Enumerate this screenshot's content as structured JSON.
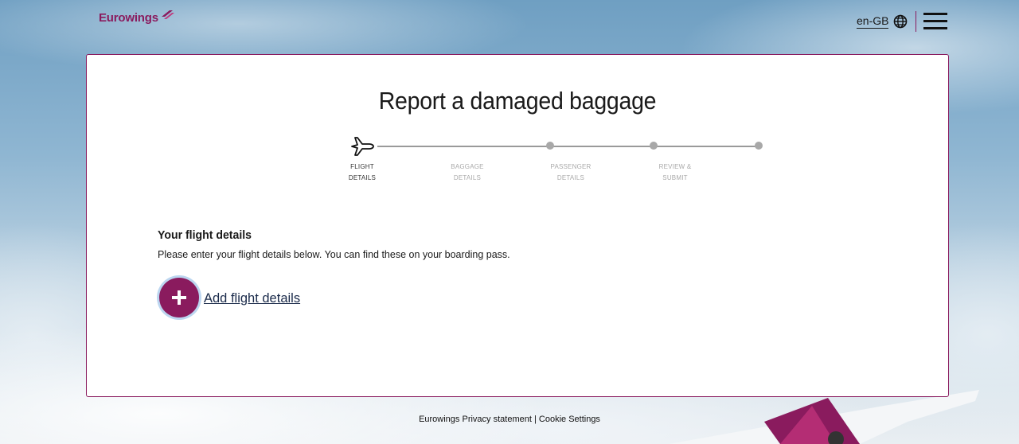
{
  "brand": {
    "name": "Eurowings",
    "color": "#8a1b5e"
  },
  "header": {
    "language": "en-GB",
    "language_icon": "globe-icon",
    "menu_icon": "hamburger-menu-icon"
  },
  "main": {
    "title": "Report a damaged baggage",
    "steps": [
      {
        "line1": "FLIGHT",
        "line2": "DETAILS",
        "active": true
      },
      {
        "line1": "BAGGAGE",
        "line2": "DETAILS",
        "active": false
      },
      {
        "line1": "PASSENGER",
        "line2": "DETAILS",
        "active": false
      },
      {
        "line1": "REVIEW &",
        "line2": "SUBMIT",
        "active": false
      }
    ],
    "section_title": "Your flight details",
    "section_text": "Please enter your flight details below. You can find these on your boarding pass.",
    "add_button_label": "Add flight details"
  },
  "footer": {
    "privacy": "Eurowings Privacy statement",
    "separator": "|",
    "cookie": "Cookie Settings"
  }
}
